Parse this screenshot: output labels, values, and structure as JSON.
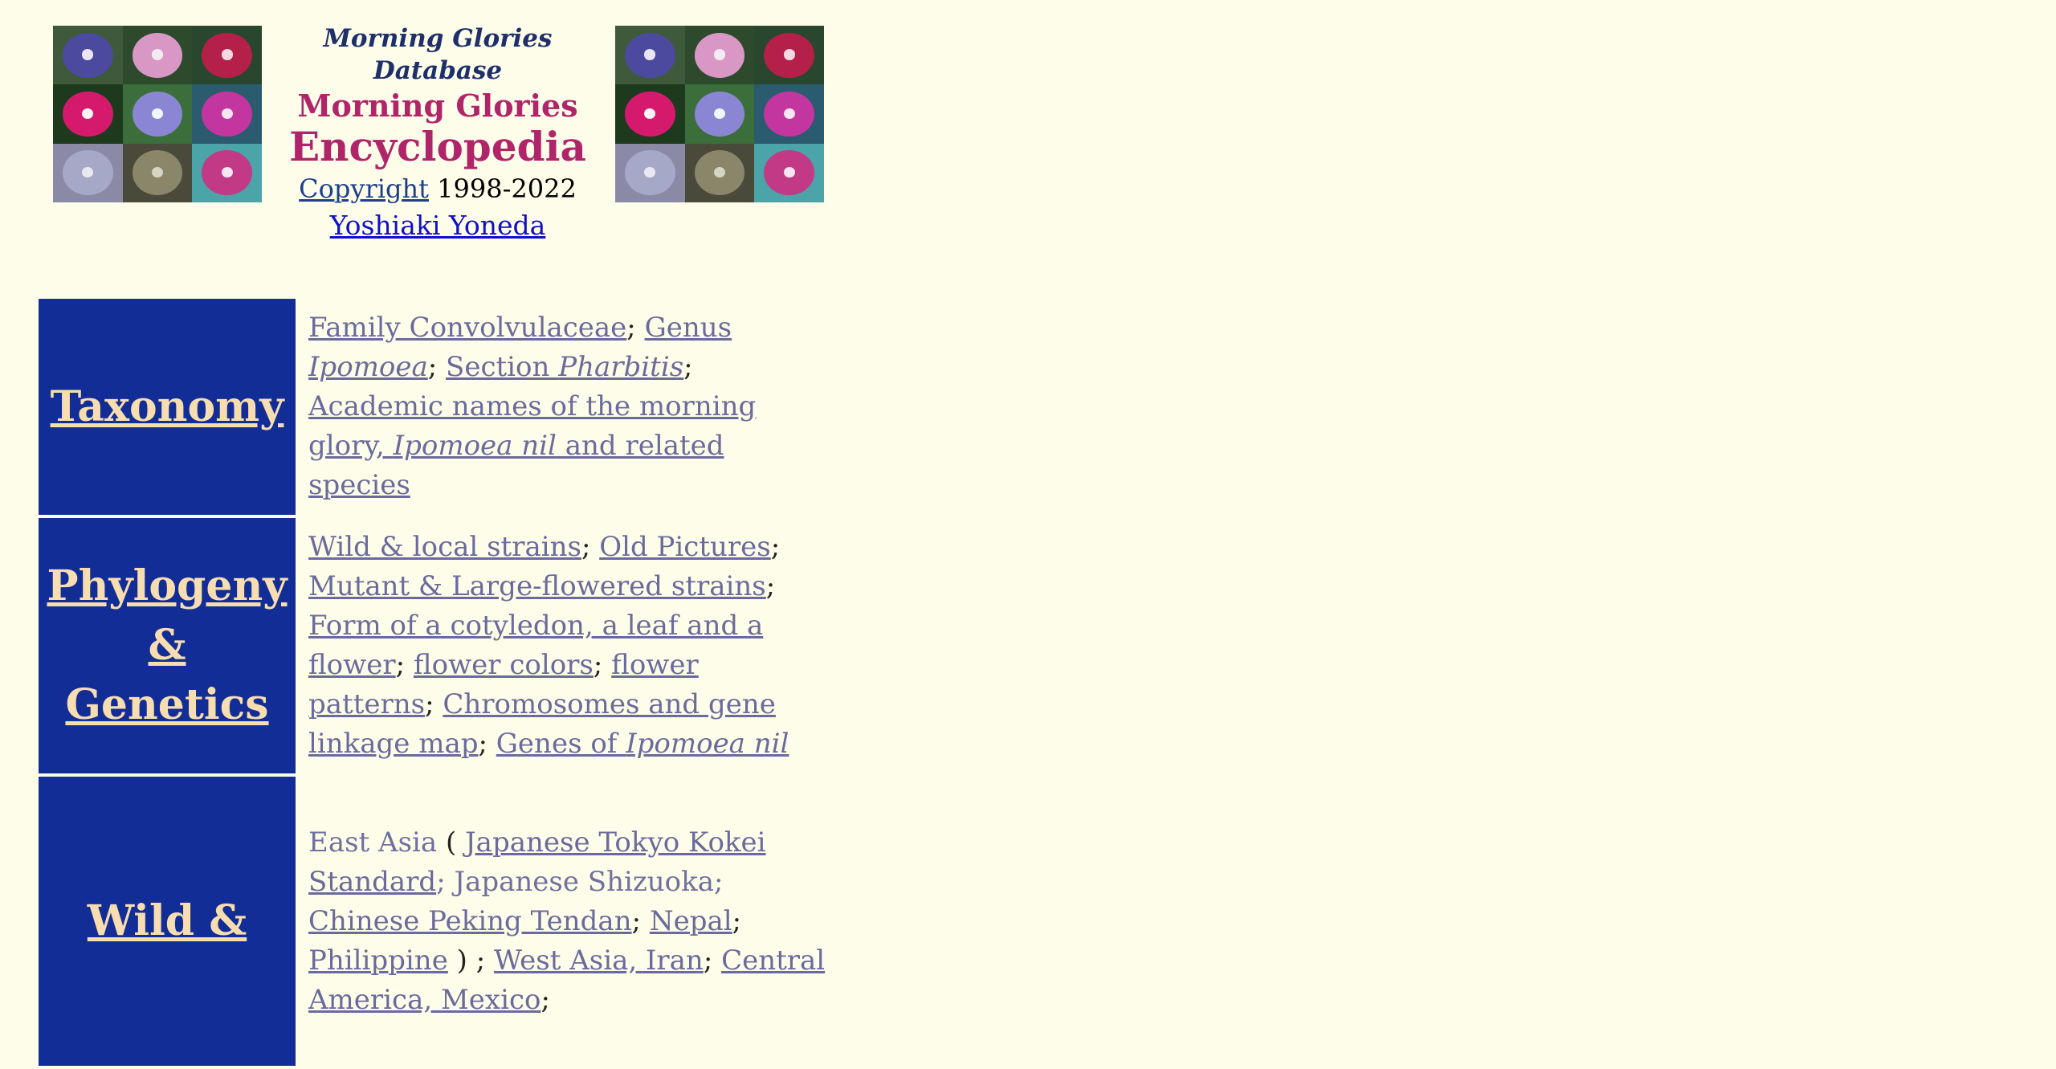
{
  "header": {
    "db_name": "Morning Glories Database",
    "title_line1": "Morning Glories",
    "title_line2": "Encyclopedia",
    "copyright_link": "Copyright",
    "copyright_years": "1998-2022",
    "author": "Yoshiaki Yoneda"
  },
  "mosaic_colors": [
    [
      "#4b4a9e",
      "#d997c6",
      "#b5204a",
      "#d51a6e",
      "#8a86d4",
      "#c4369f",
      "#9c9cc2",
      "#6b6a58",
      "#c23a86"
    ]
  ],
  "rows": [
    {
      "category": "Taxonomy",
      "links": {
        "l1": "Family Convolvulaceae",
        "l2a": "Genus ",
        "l2b": "Ipomoea",
        "l3a": "Section ",
        "l3b": "Pharbitis",
        "l4a": "Academic names of the morning glory, ",
        "l4b": "Ipomoea nil",
        "l4c": " and related species"
      }
    },
    {
      "category_line1": "Phylogeny",
      "category_line2": "& Genetics",
      "links": {
        "l1": "Wild & local strains",
        "l2": "Old Pictures",
        "l3": "Mutant & Large-flowered strains",
        "l4": "Form of a cotyledon, a leaf and a flower",
        "l5": "flower colors",
        "l6": "flower patterns",
        "l7": "Chromosomes and gene linkage map",
        "l8a": "Genes of ",
        "l8b": "Ipomoea nil"
      }
    },
    {
      "category": "Wild &",
      "text": {
        "t1": "East Asia",
        "t2": " ( ",
        "t3": "; Japanese Shizuoka; ",
        "t4": " ) ; "
      },
      "links": {
        "l1": "Japanese Tokyo Kokei Standard",
        "l2": "Chinese Peking Tendan",
        "l3": "Nepal",
        "l4": "Philippine",
        "l5": "West Asia, Iran",
        "l6": "Central America, Mexico"
      }
    }
  ],
  "colors": {
    "background": "#fdfde9",
    "category_bg": "#132d96",
    "category_text": "#f7ddb0",
    "title": "#b0246a",
    "link": "#6a6a9c",
    "author_link": "#1010c8"
  }
}
